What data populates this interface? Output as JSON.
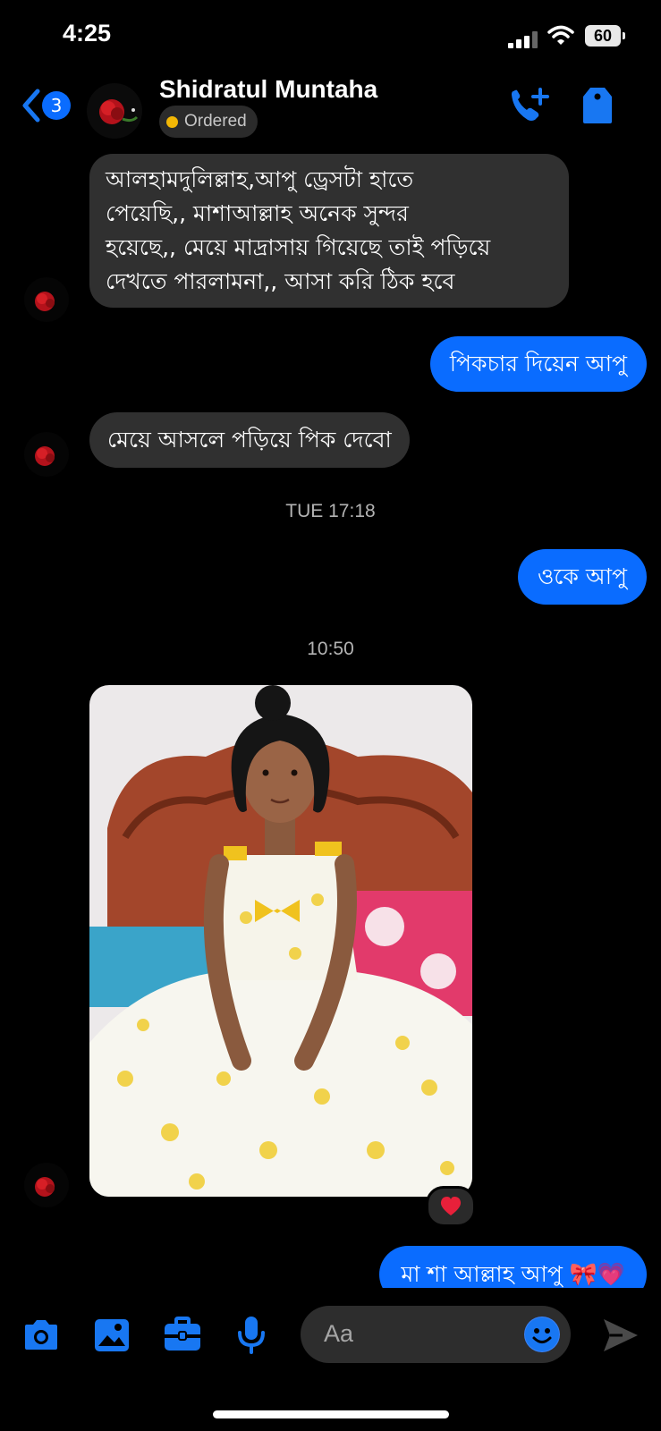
{
  "status_bar": {
    "time": "4:25",
    "battery": "60"
  },
  "header": {
    "back_badge": "3",
    "contact_name": "Shidratul Muntaha",
    "status_pill": "Ordered"
  },
  "messages": [
    {
      "side": "in",
      "lines": [
        "আলহামদুলিল্লাহ,আপু ড্রেসটা হাতে",
        "পেয়েছি,, মাশাআল্লাহ অনেক সুন্দর",
        "হয়েছে,, মেয়ে মাদ্রাসায় গিয়েছে তাই পড়িয়ে",
        "দেখতে পারলামনা,, আসা করি ঠিক হবে"
      ]
    },
    {
      "side": "out",
      "text": "পিকচার দিয়েন আপু"
    },
    {
      "side": "in",
      "text": "মেয়ে আসলে পড়িয়ে পিক দেবো"
    },
    {
      "timestamp": "TUE 17:18"
    },
    {
      "side": "out",
      "text": "ওকে আপু"
    },
    {
      "timestamp": "10:50"
    },
    {
      "side": "in",
      "type": "photo",
      "reaction": "heart"
    },
    {
      "side": "out",
      "text": "মা শা আল্লাহ  আপু 🎀💗"
    }
  ],
  "composer": {
    "placeholder": "Aa"
  },
  "colors": {
    "accent": "#0a6cff",
    "incoming": "#303030",
    "background": "#000000"
  }
}
